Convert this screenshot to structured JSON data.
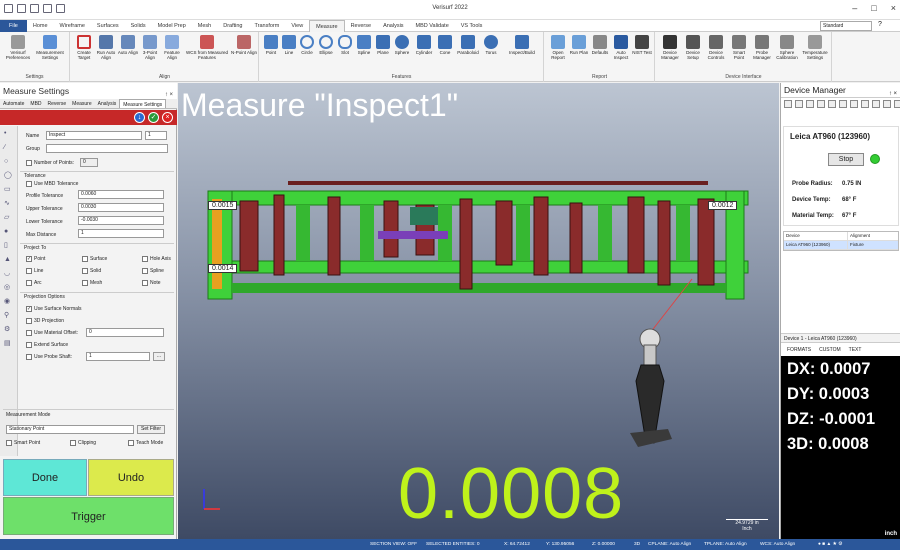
{
  "app": {
    "title": "Verisurf 2022"
  },
  "ribbon": {
    "tabs": [
      "File",
      "Home",
      "Wireframe",
      "Surfaces",
      "Solids",
      "Model Prep",
      "Mesh",
      "Drafting",
      "Transform",
      "View",
      "Measure",
      "Reverse",
      "Analysis",
      "MBD Validate",
      "VS Tools"
    ],
    "active_tab": "Measure",
    "view_select": "Standard",
    "groups": {
      "settings": {
        "label": "Settings",
        "buttons": [
          "Verisurf Preferences",
          "Measurement Settings"
        ]
      },
      "align": {
        "label": "Align",
        "buttons": [
          "Create Target",
          "Run Auto Align",
          "Auto Align",
          "3-Point Align",
          "Feature Align",
          "WCS from Measured Features",
          "N-Point Align"
        ]
      },
      "features": {
        "label": "Features",
        "buttons": [
          "Point",
          "Line",
          "Circle",
          "Ellipse",
          "Slot",
          "Spline",
          "Plane",
          "Sphere",
          "Cylinder",
          "Cone",
          "Paraboloid",
          "Torus",
          "Inspect/Build"
        ]
      },
      "report": {
        "label": "Report",
        "buttons": [
          "Open Report",
          "Run Plan",
          "Defaults",
          "Auto Inspect",
          "NIST Test"
        ]
      },
      "device": {
        "label": "Device Interface",
        "buttons": [
          "Device Manager",
          "Device Setup",
          "Device Controls",
          "Smart Point",
          "Probe Manager",
          "Sphere Calibration",
          "Temperature Settings"
        ]
      }
    }
  },
  "left_panel": {
    "title": "Measure Settings",
    "pin": "↑ ×",
    "tabs": [
      "Automate",
      "MBD",
      "Reverse",
      "Measure",
      "Analysis",
      "Measure Settings"
    ],
    "active_tab": "Measure Settings",
    "toolbar_icons": [
      "↓",
      "✓",
      "×"
    ],
    "name_label": "Name",
    "name_value": "Inspect",
    "name_index": "1",
    "group_label": "Group",
    "group_value": "",
    "number_of_points_label": "Number of Points:",
    "number_of_points_value": "0",
    "tolerance": {
      "section": "Tolerance",
      "use_mbd": "Use MBD Tolerance",
      "profile_label": "Profile Tolerance",
      "profile_value": "0.0060",
      "upper_label": "Upper Tolerance",
      "upper_value": "0.0030",
      "lower_label": "Lower Tolerance",
      "lower_value": "-0.0030",
      "max_label": "Max Distance",
      "max_value": "1"
    },
    "project_to": {
      "section": "Project To",
      "items": [
        {
          "label": "Point",
          "checked": true
        },
        {
          "label": "Surface",
          "checked": false
        },
        {
          "label": "Hole Axis",
          "checked": false
        },
        {
          "label": "Line",
          "checked": false
        },
        {
          "label": "Solid",
          "checked": false
        },
        {
          "label": "Spline",
          "checked": false
        },
        {
          "label": "Arc",
          "checked": false
        },
        {
          "label": "Mesh",
          "checked": false
        },
        {
          "label": "Note",
          "checked": false
        }
      ]
    },
    "projection_options": {
      "section": "Projection Options",
      "use_surface_normals": "Use Surface Normals",
      "projection_3d": "3D Projection",
      "use_material_offset": "Use Material Offset:",
      "material_offset_value": "0",
      "extend_surface": "Extend Surface",
      "use_probe_shaft": "Use Probe Shaft:",
      "probe_shaft_value": "1",
      "probe_shaft_btn": "..."
    },
    "measurement_mode": {
      "section": "Measurement Mode",
      "value": "Stationary Point",
      "set_filter": "Set Filter",
      "smart_point": "Smart Point",
      "clipping": "Clipping",
      "teach_mode": "Teach Mode"
    },
    "buttons": {
      "done": "Done",
      "undo": "Undo",
      "trigger": "Trigger"
    }
  },
  "viewport": {
    "title": "Measure \"Inspect1\"",
    "reading": "0.0008",
    "labels": [
      "0.0015",
      "0.0012",
      "0.0014"
    ],
    "scale_value": "24.9729 in",
    "scale_unit": "Inch"
  },
  "device_manager": {
    "title": "Device Manager",
    "pin": "↑ ×",
    "device_name": "Leica AT960 (123960)",
    "stop_label": "Stop",
    "probe_radius_label": "Probe Radius:",
    "probe_radius_value": "0.75 IN",
    "device_temp_label": "Device Temp:",
    "device_temp_value": "68° F",
    "material_temp_label": "Material Temp:",
    "material_temp_value": "67° F",
    "table_headers": [
      "Device",
      "Alignment"
    ],
    "table_rows": [
      {
        "device": "Leica AT960 (123960)",
        "alignment": "Fixture"
      }
    ]
  },
  "dro": {
    "header": "Device 1 - Leica AT960 (123960)",
    "tabs": [
      "FORMATS",
      "CUSTOM",
      "TEXT"
    ],
    "dx": "DX:  0.0007",
    "dy": "DY:  0.0003",
    "dz": "DZ: -0.0001",
    "d3": "3D:  0.0008",
    "unit": "inch"
  },
  "status_bar": {
    "section_view": "SECTION VIEW: OFF",
    "selected_entities": "SELECTED ENTITIES: 0",
    "x": "X:    64.72412",
    "y": "Y:    130.95056",
    "z": "Z:    0.00000",
    "mode": "3D",
    "cplane": "CPLANE: Auto Align",
    "tplane": "TPLANE: Auto Align",
    "wcs": "WCS: Auto Align"
  },
  "colors": {
    "accent": "#2b579a",
    "toolbar_red": "#c62828",
    "reading_green": "#bff21b",
    "fixture_green": "#3fd13a"
  }
}
